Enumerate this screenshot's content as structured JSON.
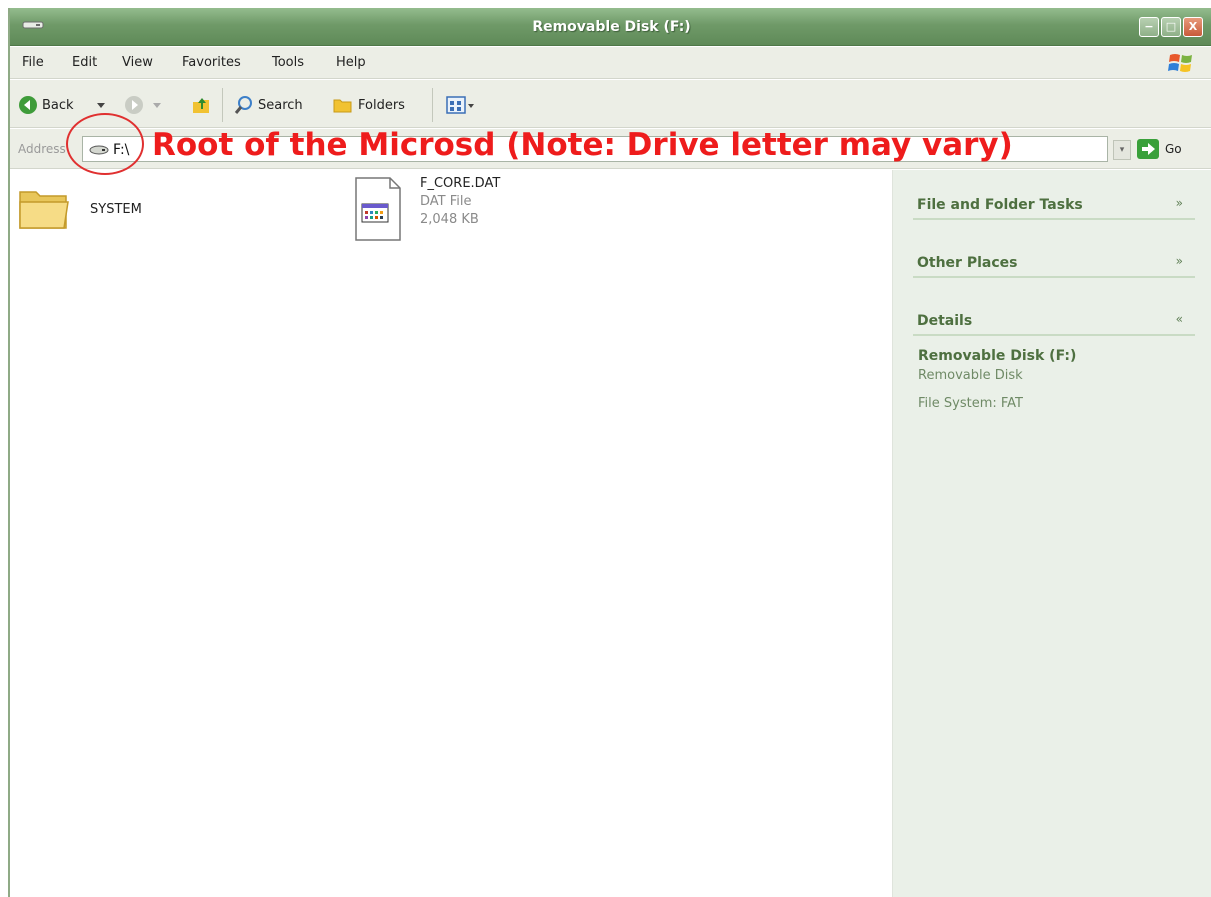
{
  "window": {
    "title": "Removable Disk (F:)",
    "controls": {
      "minimize": "−",
      "maximize": "□",
      "close": "X"
    }
  },
  "menu": [
    "File",
    "Edit",
    "View",
    "Favorites",
    "Tools",
    "Help"
  ],
  "toolbar": {
    "back_label": "Back",
    "search_label": "Search",
    "folders_label": "Folders"
  },
  "address": {
    "label": "Address",
    "value": "F:\\",
    "go_label": "Go"
  },
  "annotation": {
    "text": "Root of the Microsd (Note: Drive letter may vary)",
    "color": "#ee1c1c"
  },
  "files": {
    "folder": {
      "name": "SYSTEM"
    },
    "dat": {
      "name": "F_CORE.DAT",
      "type": "DAT File",
      "size": "2,048 KB"
    }
  },
  "taskpane": {
    "sections": [
      {
        "title": "File and Folder Tasks",
        "chevron": "»"
      },
      {
        "title": "Other Places",
        "chevron": "»"
      },
      {
        "title": "Details",
        "chevron": "«"
      }
    ],
    "details": {
      "name": "Removable Disk (F:)",
      "type": "Removable Disk",
      "filesystem": "File System: FAT"
    }
  },
  "colors": {
    "titlebar": "#6f9a68",
    "taskpane_bg": "#eaf0e8",
    "taskpane_heading": "#4e7040",
    "annotation": "#ee1c1c"
  }
}
